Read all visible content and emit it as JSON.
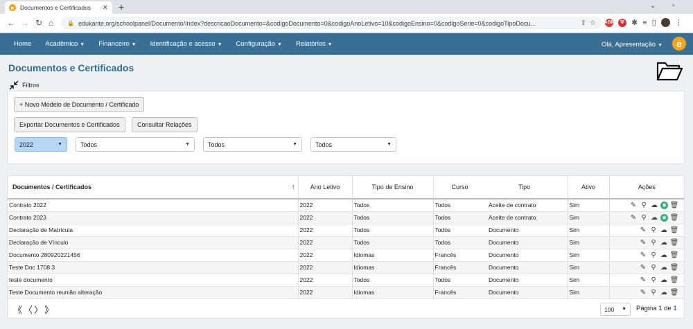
{
  "browser": {
    "tab_title": "Documentos e Certificados",
    "tab_close": "✕",
    "new_tab": "+",
    "url": "edukante.org/schoolpanel/Documento/Index?descricaoDocumento=&codigoDocumento=0&codigoAnoLetivo=10&codigoEnsino=0&codigoSerie=0&codigoTipoDocu..."
  },
  "nav": {
    "home": "Home",
    "academico": "Acadêmico",
    "financeiro": "Financeiro",
    "identificacao": "Identificação e acesso",
    "configuracao": "Configuração",
    "relatorios": "Relatórios",
    "user": "Olá, Apresentação",
    "logo": "e"
  },
  "page": {
    "title": "Documentos e Certificados",
    "filters_label": "Filtros"
  },
  "actions": {
    "new_model": "+ Novo Modelo de Documento / Certificado",
    "export": "Exportar Documentos e Certificados",
    "relations": "Consultar Relações"
  },
  "filters": {
    "year": "2022",
    "ensino": "Todos",
    "serie": "Todos",
    "tipo": "Todos"
  },
  "table": {
    "headers": {
      "documento": "Documentos / Certificados",
      "ano": "Ano Letivo",
      "ensino": "Tipo de Ensino",
      "curso": "Curso",
      "tipo": "Tipo",
      "ativo": "Ativo",
      "acoes": "Ações"
    },
    "rows": [
      {
        "documento": "Contrato 2022",
        "ano": "2022",
        "ensino": "Todos",
        "curso": "Todos",
        "tipo": "Aceite de contrato",
        "ativo": "Sim"
      },
      {
        "documento": "Contrato 2023",
        "ano": "2022",
        "ensino": "Todos",
        "curso": "Todos",
        "tipo": "Aceite de contrato",
        "ativo": "Sim"
      },
      {
        "documento": "Declaração de Matrícula",
        "ano": "2022",
        "ensino": "Todos",
        "curso": "Todos",
        "tipo": "Documento",
        "ativo": "Sim"
      },
      {
        "documento": "Declaração de Vínculo",
        "ano": "2022",
        "ensino": "Todos",
        "curso": "Todos",
        "tipo": "Documento",
        "ativo": "Sim"
      },
      {
        "documento": "Documento 280920221456",
        "ano": "2022",
        "ensino": "Idiomas",
        "curso": "Francês",
        "tipo": "Documento",
        "ativo": "Sim"
      },
      {
        "documento": "Teste Doc 1708 3",
        "ano": "2022",
        "ensino": "Idiomas",
        "curso": "Francês",
        "tipo": "Documento",
        "ativo": "Sim"
      },
      {
        "documento": "teste documento",
        "ano": "2022",
        "ensino": "Todos",
        "curso": "Todos",
        "tipo": "Documento",
        "ativo": "Sim"
      },
      {
        "documento": "Teste Documento reunião alteração",
        "ano": "2022",
        "ensino": "Idiomas",
        "curso": "Francês",
        "tipo": "Documento",
        "ativo": "Sim"
      }
    ]
  },
  "pagination": {
    "per_page": "100",
    "info": "Página 1 de 1"
  }
}
